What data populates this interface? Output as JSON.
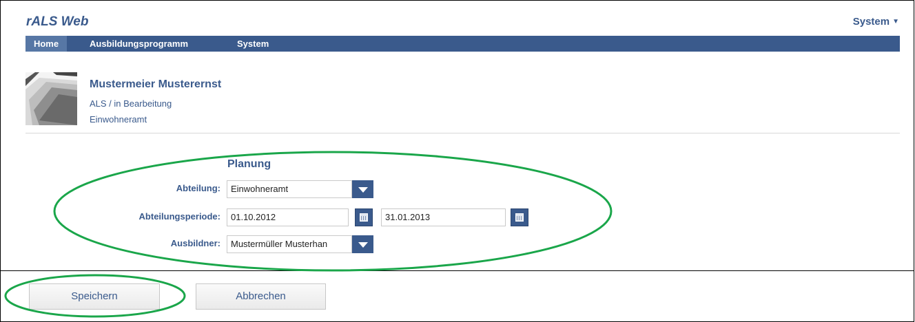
{
  "app": {
    "title": "rALS Web",
    "system_menu": "System"
  },
  "nav": {
    "items": [
      {
        "label": "Home"
      },
      {
        "label": "Ausbildungsprogramm"
      },
      {
        "label": "System"
      }
    ]
  },
  "person": {
    "name": "Mustermeier Musterernst",
    "status": "ALS / in Bearbeitung",
    "department": "Einwohneramt"
  },
  "form": {
    "title": "Planung",
    "abteilung": {
      "label": "Abteilung:",
      "value": "Einwohneramt"
    },
    "periode": {
      "label": "Abteilungsperiode:",
      "from": "01.10.2012",
      "to": "31.01.2013"
    },
    "ausbildner": {
      "label": "Ausbildner:",
      "value": "Mustermüller Musterhan"
    }
  },
  "buttons": {
    "save": "Speichern",
    "cancel": "Abbrechen"
  },
  "colors": {
    "brand": "#3a5a8c",
    "annotation": "#1aa64a"
  }
}
